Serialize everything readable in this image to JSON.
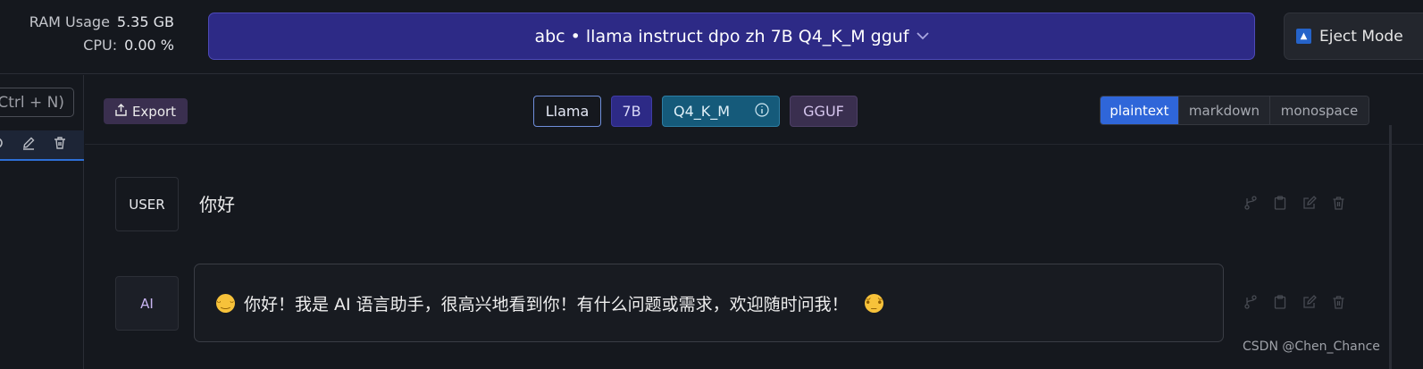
{
  "stats": {
    "ram_label": "RAM Usage",
    "ram_value": "5.35 GB",
    "cpu_label": "CPU:",
    "cpu_value": "0.00 %"
  },
  "model_selector": {
    "label": "abc • llama instruct dpo zh 7B Q4_K_M gguf",
    "chevron_icon": "chevron-down-icon"
  },
  "eject": {
    "label": "Eject Mode"
  },
  "sidebar": {
    "new_chat_label": "Ctrl + N)",
    "chat_item_icons": [
      "edit-icon",
      "trash-icon"
    ]
  },
  "toolbar": {
    "export_label": "Export",
    "tags": {
      "family": "Llama",
      "size": "7B",
      "quant": "Q4_K_M",
      "format": "GGUF"
    },
    "formats": [
      "plaintext",
      "markdown",
      "monospace"
    ],
    "active_format": "plaintext"
  },
  "messages": [
    {
      "role": "USER",
      "text": "你好"
    },
    {
      "role": "AI",
      "text": "你好！我是 AI 语言助手，很高兴地看到你！有什么问题或需求，欢迎随时问我！"
    }
  ],
  "watermark": "CSDN @Chen_Chance",
  "colors": {
    "accent": "#2d2a86",
    "active_format": "#2f66d9",
    "quant_tag": "#155a7a"
  }
}
